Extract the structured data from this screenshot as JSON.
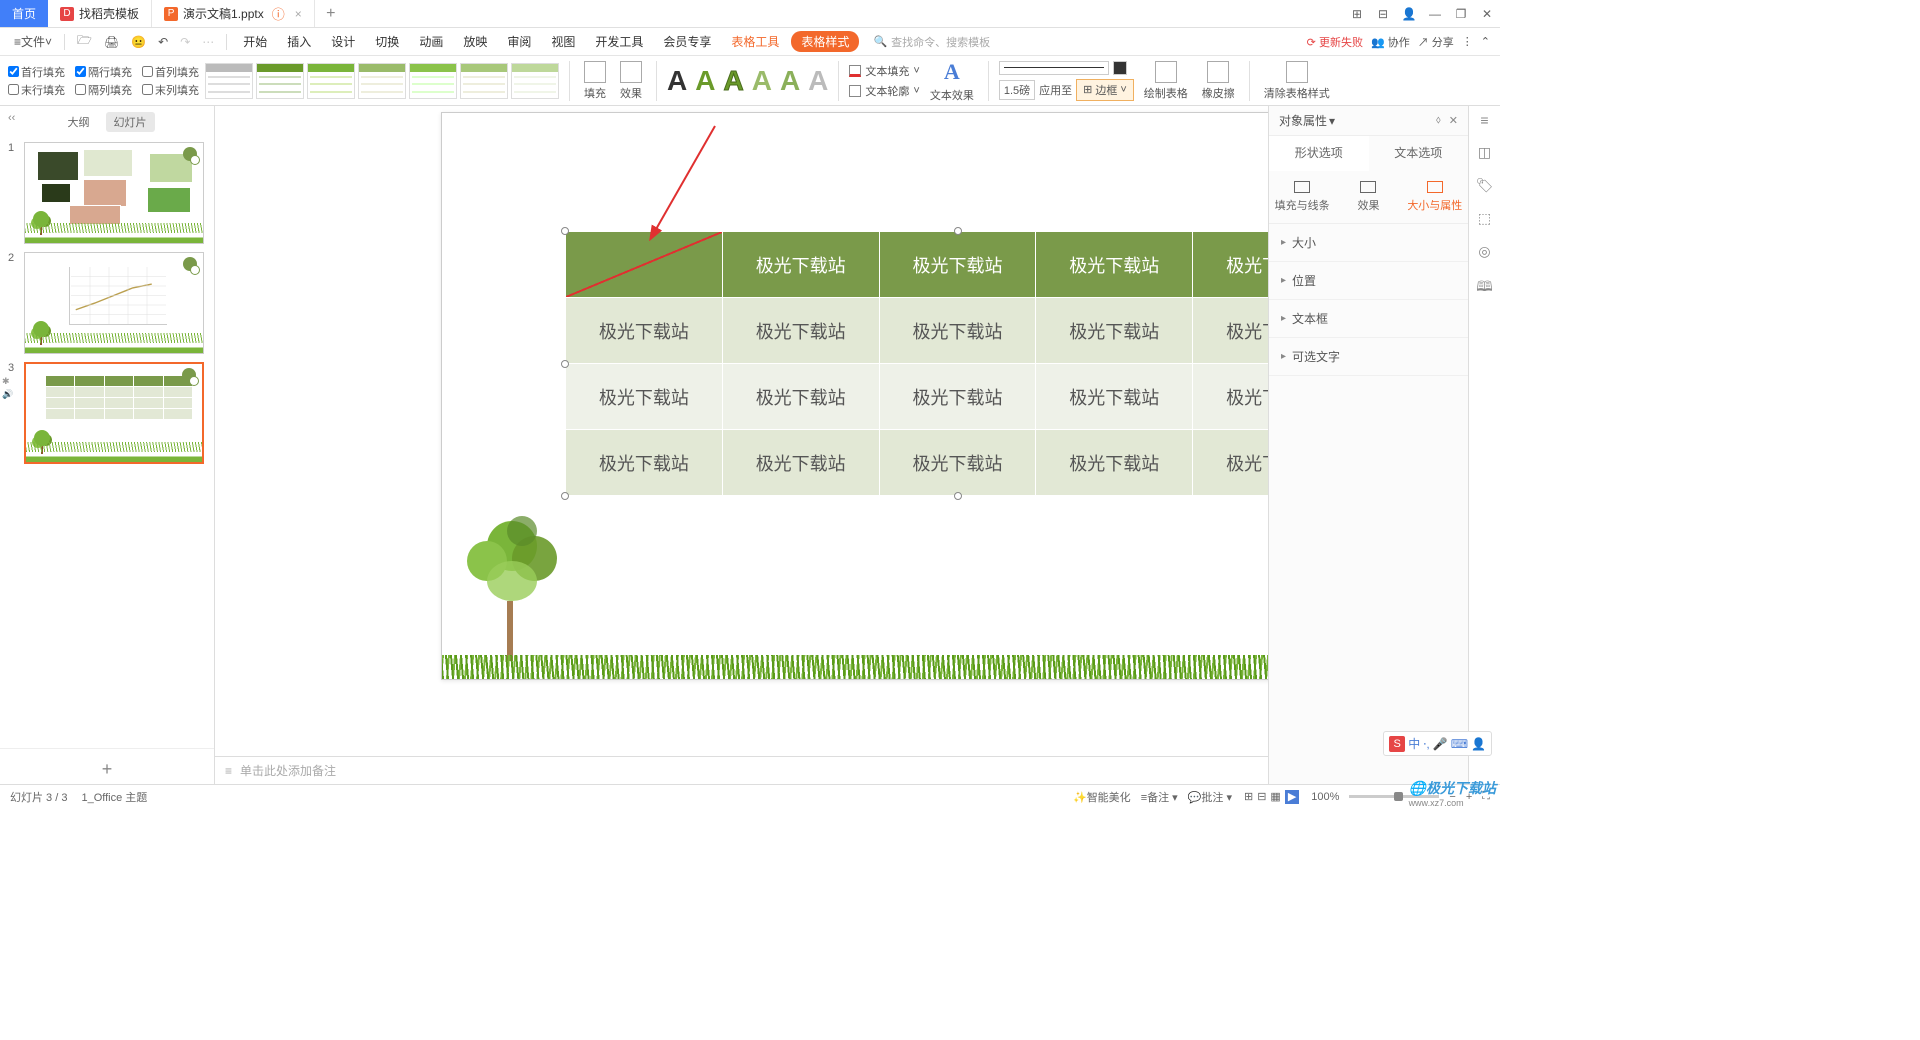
{
  "tabs": {
    "home": "首页",
    "template": "找稻壳模板",
    "file": "演示文稿1.pptx"
  },
  "menus": {
    "file": "文件",
    "start": "开始",
    "insert": "插入",
    "design": "设计",
    "transition": "切换",
    "animation": "动画",
    "slideshow": "放映",
    "review": "审阅",
    "view": "视图",
    "dev": "开发工具",
    "member": "会员专享",
    "tabletool": "表格工具",
    "tablestyle": "表格样式"
  },
  "search_placeholder": "查找命令、搜索模板",
  "top_right": {
    "fail": "更新失败",
    "collab": "协作",
    "share": "分享"
  },
  "ribbon": {
    "cb": {
      "header_row": "首行填充",
      "banded_row": "隔行填充",
      "first_col": "首列填充",
      "total_row": "末行填充",
      "banded_col": "隔列填充",
      "last_col": "末列填充"
    },
    "fill": "填充",
    "effect": "效果",
    "text_fill": "文本填充",
    "text_outline": "文本轮廓",
    "text_effect": "文本效果",
    "width": "1.5磅",
    "apply": "应用至",
    "border": "边框",
    "draw": "绘制表格",
    "eraser": "橡皮擦",
    "clear": "清除表格样式"
  },
  "outline_tab": "大纲",
  "slides_tab": "幻灯片",
  "table_cell": "极光下载站",
  "notes_placeholder": "单击此处添加备注",
  "panel": {
    "title": "对象属性",
    "shape_opt": "形状选项",
    "text_opt": "文本选项",
    "fill_line": "填充与线条",
    "effect": "效果",
    "size_prop": "大小与属性",
    "size": "大小",
    "position": "位置",
    "textbox": "文本框",
    "alttext": "可选文字"
  },
  "status": {
    "slide": "幻灯片 3 / 3",
    "theme": "1_Office 主题",
    "ai": "智能美化",
    "notes": "备注",
    "comment": "批注",
    "zoom": "100%"
  },
  "ime_text": "中",
  "watermark": "极光下载站",
  "watermark_url": "www.xz7.com"
}
